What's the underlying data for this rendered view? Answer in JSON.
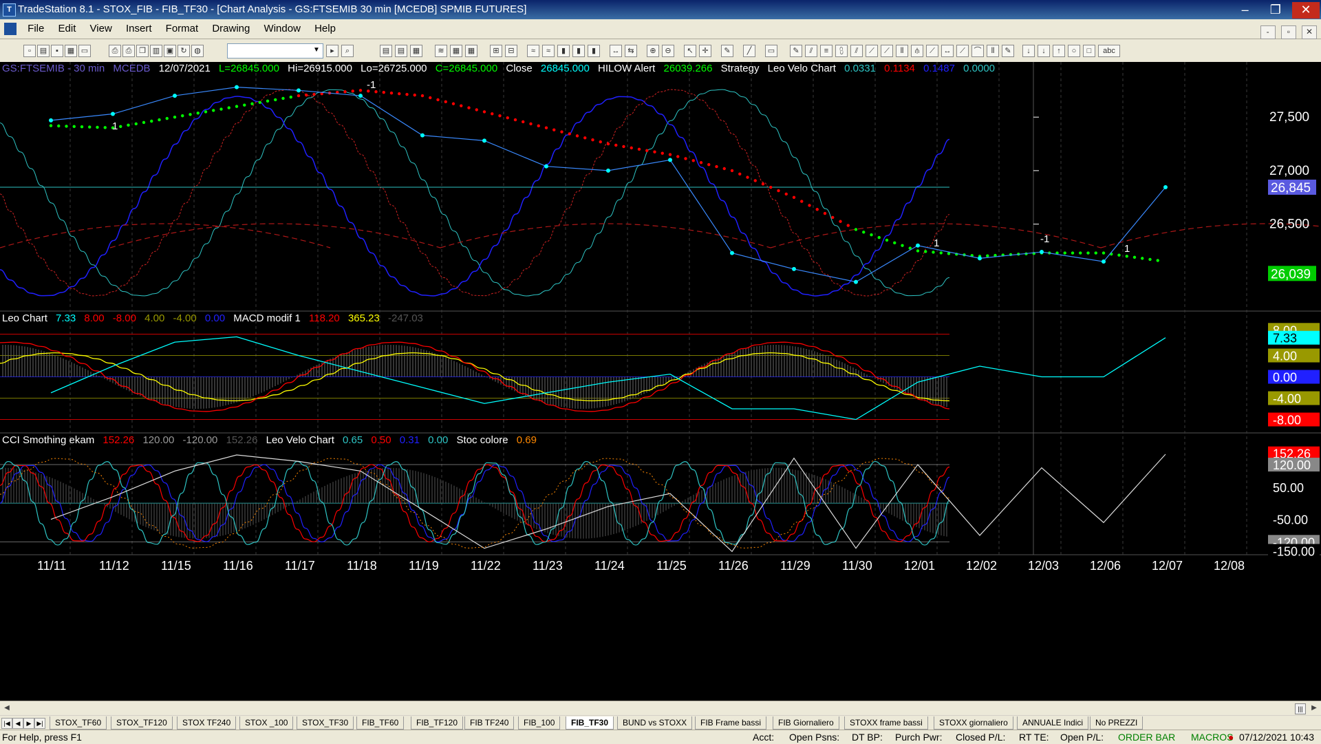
{
  "window": {
    "title": "TradeStation 8.1 - STOX_FIB - FIB_TF30 - [Chart Analysis - GS:FTSEMIB  30 min  [MCEDB] SPMIB FUTURES]",
    "minimize": "‒",
    "restore": "❐",
    "close": "✕"
  },
  "menu": [
    "File",
    "Edit",
    "View",
    "Insert",
    "Format",
    "Drawing",
    "Window",
    "Help"
  ],
  "mdi": {
    "minimize": "-",
    "restore": "▫",
    "close": "✕"
  },
  "toolbar": {
    "combo_value": "",
    "text_tool": "abc"
  },
  "colors": {
    "cyan": "#00ffff",
    "red": "#ff0000",
    "yellow": "#ffff00",
    "blue": "#2020ff",
    "green": "#00ff00",
    "gray": "#808080",
    "teal": "#2ec5c5",
    "white": "#ffffff",
    "orange": "#ff8800"
  },
  "panel1": {
    "header": {
      "symbol": "GS:FTSEMIB - 30 min",
      "data_source": "MCEDB",
      "date": "12/07/2021",
      "last": "L=26845.000",
      "high": "Hi=26915.000",
      "low": "Lo=26725.000",
      "close": "C=26845.000",
      "close_label": "Close",
      "close_value": "26845.000",
      "hilow_label": "HILOW Alert",
      "hilow_value": "26039.266",
      "strategy_label": "Strategy",
      "indicator": "Leo Velo Chart",
      "iv1": "0.0331",
      "iv2": "0.1134",
      "iv3": "0.1487",
      "iv4": "0.0000"
    },
    "signals": [
      "-1",
      "1",
      "1",
      "-1",
      "1"
    ],
    "price_badges": {
      "close": "26,845",
      "hilow": "26,039"
    }
  },
  "panel2": {
    "header": {
      "indicator": "Leo Chart",
      "v1": "7.33",
      "v2": "8.00",
      "v3": "-8.00",
      "v4": "4.00",
      "v5": "-4.00",
      "v6": "0.00",
      "macd_label": "MACD modif 1",
      "m1": "118.20",
      "m2": "365.23",
      "m3": "-247.03"
    },
    "badges": {
      "top": "8.00",
      "cur": "7.33",
      "b1": "4.00",
      "b2": "0.00",
      "b3": "-4.00",
      "b4": "-8.00"
    }
  },
  "panel3": {
    "header": {
      "indicator": "CCI Smothing ekam",
      "c1": "152.26",
      "c2": "120.00",
      "c3": "-120.00",
      "c4": "152.26",
      "velo_label": "Leo Velo Chart",
      "l1": "0.65",
      "l2": "0.50",
      "l3": "0.31",
      "l4": "0.00",
      "stoc_label": "Stoc colore",
      "s1": "0.69"
    },
    "badges": {
      "cur": "152.26",
      "b1": "120.00",
      "b2": "50.00",
      "b3": "-50.00",
      "b4": "-120.00",
      "b5": "-150.00"
    }
  },
  "chart_data": [
    {
      "type": "line",
      "title": "GS:FTSEMIB - 30 min",
      "x": [
        "11/11",
        "11/12",
        "11/15",
        "11/16",
        "11/17",
        "11/18",
        "11/19",
        "11/22",
        "11/23",
        "11/24",
        "11/25",
        "11/26",
        "11/29",
        "11/30",
        "12/01",
        "12/02",
        "12/03",
        "12/06",
        "12/07",
        "12/08"
      ],
      "ylim": [
        25700,
        27900
      ],
      "y_ticks": [
        "27,500",
        "27,000",
        "26,500"
      ],
      "series": [
        {
          "name": "Close",
          "values": [
            27470,
            27530,
            27700,
            27780,
            27750,
            27700,
            27330,
            27280,
            27040,
            27000,
            27100,
            26230,
            26080,
            25960,
            26300,
            26180,
            26240,
            26150,
            26845,
            null
          ]
        },
        {
          "name": "HILOW Alert",
          "values": [
            27420,
            27400,
            27500,
            27600,
            27700,
            27750,
            27700,
            27550,
            27400,
            27250,
            27150,
            27000,
            26750,
            26450,
            26250,
            26200,
            26230,
            26230,
            26150,
            null
          ]
        }
      ]
    },
    {
      "type": "line",
      "title": "Leo Chart",
      "x": [
        "11/11",
        "11/12",
        "11/15",
        "11/16",
        "11/17",
        "11/18",
        "11/19",
        "11/22",
        "11/23",
        "11/24",
        "11/25",
        "11/26",
        "11/29",
        "11/30",
        "12/01",
        "12/02",
        "12/03",
        "12/06",
        "12/07",
        "12/08"
      ],
      "ylim": [
        -10,
        10
      ],
      "y_ticks": [
        "7.33",
        "4.00",
        "0.00",
        "-4.00",
        "-8.00"
      ],
      "series": [
        {
          "name": "Leo Chart",
          "values": [
            -3,
            2,
            6.5,
            7.5,
            4,
            1,
            -2,
            -5,
            -3,
            -1,
            0.5,
            -6,
            -6,
            -8,
            -1,
            2,
            0,
            0,
            7.33,
            null
          ]
        }
      ]
    },
    {
      "type": "line",
      "title": "CCI Smothing ekam",
      "x": [
        "11/11",
        "11/12",
        "11/15",
        "11/16",
        "11/17",
        "11/18",
        "11/19",
        "11/22",
        "11/23",
        "11/24",
        "11/25",
        "11/26",
        "11/29",
        "11/30",
        "12/01",
        "12/02",
        "12/03",
        "12/06",
        "12/07",
        "12/08"
      ],
      "ylim": [
        -160,
        180
      ],
      "y_ticks": [
        "152.26",
        "120.00",
        "50.00",
        "-50.00",
        "-120.00",
        "-150.00"
      ],
      "series": [
        {
          "name": "CCI Smothing ekam",
          "values": [
            -50,
            20,
            100,
            150,
            130,
            100,
            -20,
            -140,
            -80,
            -10,
            30,
            -150,
            140,
            -140,
            120,
            -100,
            110,
            -60,
            152.26,
            null
          ]
        }
      ]
    }
  ],
  "scrollbar": {
    "left": "◀",
    "right": "▶",
    "thumb": "|||"
  },
  "tabs": [
    "STOX_TF60",
    "STOX_TF120",
    "STOX TF240",
    "STOX _100",
    "STOX_TF30",
    "FIB_TF60",
    "FIB_TF120",
    "FIB TF240",
    "FIB_100",
    "FIB_TF30",
    "BUND vs STOXX",
    "FIB Frame bassi",
    "FIB Giornaliero",
    "STOXX frame bassi",
    "STOXX giornaliero",
    "ANNUALE Indici",
    "No PREZZI"
  ],
  "tab_nav": [
    "|◀",
    "◀",
    "▶",
    "▶|"
  ],
  "status": {
    "help": "For Help, press F1",
    "acct": "Acct:",
    "open_psns": "Open Psns:",
    "dt_bp": "DT BP:",
    "purch_pwr": "Purch Pwr:",
    "closed_pl": "Closed P/L:",
    "rt_te": "RT TE:",
    "open_pl": "Open P/L:",
    "order_bar": "ORDER BAR",
    "macros": "MACROS",
    "datetime": "07/12/2021 10:43"
  }
}
